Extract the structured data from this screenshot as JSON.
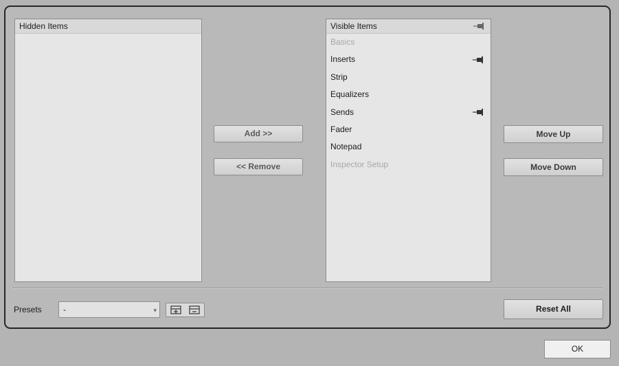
{
  "hidden_list": {
    "header": "Hidden Items",
    "items": []
  },
  "visible_list": {
    "header": "Visible Items",
    "items": [
      {
        "label": "Basics",
        "disabled": true,
        "pinned": false
      },
      {
        "label": "Inserts",
        "disabled": false,
        "pinned": true
      },
      {
        "label": "Strip",
        "disabled": false,
        "pinned": false
      },
      {
        "label": "Equalizers",
        "disabled": false,
        "pinned": false
      },
      {
        "label": "Sends",
        "disabled": false,
        "pinned": true
      },
      {
        "label": "Fader",
        "disabled": false,
        "pinned": false
      },
      {
        "label": "Notepad",
        "disabled": false,
        "pinned": false
      },
      {
        "label": "Inspector Setup",
        "disabled": true,
        "pinned": false
      }
    ]
  },
  "buttons": {
    "add": "Add >>",
    "remove": "<< Remove",
    "move_up": "Move Up",
    "move_down": "Move Down",
    "reset_all": "Reset All",
    "ok": "OK"
  },
  "presets": {
    "label": "Presets",
    "value": "-"
  },
  "icons": {
    "pin": "pin-icon",
    "save_preset": "save-preset-icon",
    "remove_preset": "remove-preset-icon",
    "dropdown": "chevron-down-icon"
  }
}
